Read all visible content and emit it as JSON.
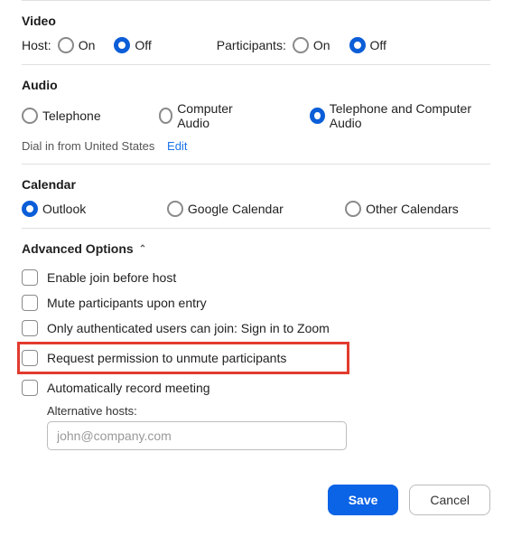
{
  "video": {
    "title": "Video",
    "host_label": "Host:",
    "participants_label": "Participants:",
    "on": "On",
    "off": "Off",
    "host_selected": "off",
    "participants_selected": "off"
  },
  "audio": {
    "title": "Audio",
    "options": {
      "telephone": "Telephone",
      "computer": "Computer Audio",
      "both": "Telephone and Computer Audio"
    },
    "selected": "both",
    "dial_text": "Dial in from United States",
    "edit": "Edit"
  },
  "calendar": {
    "title": "Calendar",
    "options": {
      "outlook": "Outlook",
      "google": "Google Calendar",
      "other": "Other Calendars"
    },
    "selected": "outlook"
  },
  "advanced": {
    "title": "Advanced Options",
    "options": {
      "join_before_host": "Enable join before host",
      "mute_on_entry": "Mute participants upon entry",
      "auth_only": "Only authenticated users can join: Sign in to Zoom",
      "request_unmute": "Request permission to unmute participants",
      "auto_record": "Automatically record meeting"
    },
    "alt_hosts_label": "Alternative hosts:",
    "alt_hosts_placeholder": "john@company.com"
  },
  "footer": {
    "save": "Save",
    "cancel": "Cancel"
  }
}
